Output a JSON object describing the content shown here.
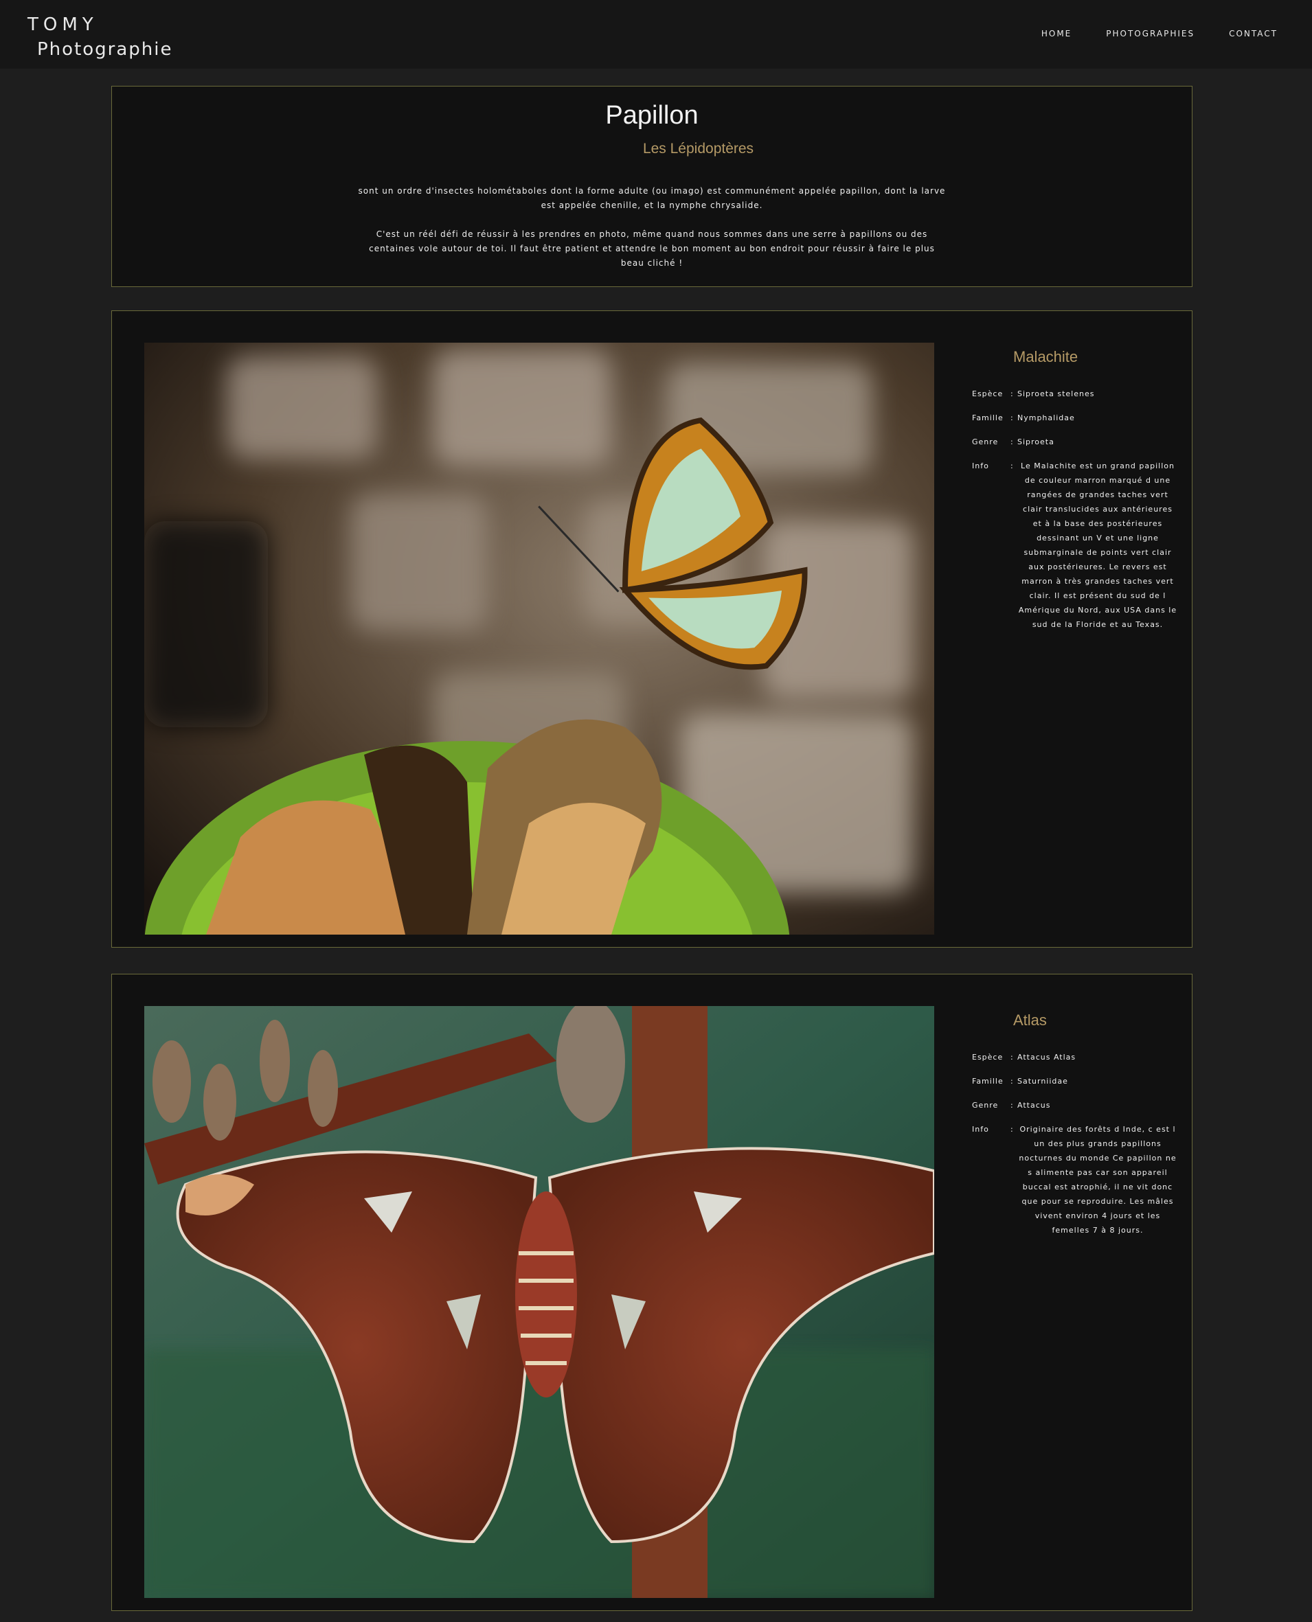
{
  "header": {
    "logo_line1": "TOMY",
    "logo_line2": "Photographie",
    "nav": [
      {
        "label": "HOME"
      },
      {
        "label": "PHOTOGRAPHIES"
      },
      {
        "label": "CONTACT"
      }
    ]
  },
  "intro": {
    "title": "Papillon",
    "subtitle": "Les Lépidoptères",
    "paragraph1": "sont un ordre d'insectes holométaboles dont la forme adulte (ou imago) est communément appelée papillon, dont la larve est appelée chenille, et la nymphe chrysalide.",
    "paragraph2": "C'est un réél défi de réussir à les prendres en photo, même quand nous sommes dans une serre à papillons ou des centaines vole autour de toi. Il faut être patient et attendre le bon moment au bon endroit pour réussir à faire le plus beau cliché !"
  },
  "cards": [
    {
      "name": "Malachite",
      "espece_label": "Espèce",
      "espece": "Siproeta stelenes",
      "famille_label": "Famille",
      "famille": "Nymphalidae",
      "genre_label": "Genre",
      "genre": "Siproeta",
      "info_label": "Info",
      "info": "Le Malachite est un grand papillon de couleur marron marqué d une rangées de grandes taches vert clair translucides aux antérieures et à la base des postérieures dessinant un V et une ligne submarginale de points vert clair aux postérieures. Le revers est marron à très grandes taches vert clair. Il est présent du sud de l Amérique du Nord, aux USA dans le sud de la Floride et au Texas."
    },
    {
      "name": "Atlas",
      "espece_label": "Espèce",
      "espece": "Attacus Atlas",
      "famille_label": "Famille",
      "famille": "Saturniidae",
      "genre_label": "Genre",
      "genre": "Attacus",
      "info_label": "Info",
      "info": "Originaire des forêts d Inde, c est l un des plus grands papillons nocturnes du monde Ce papillon ne s alimente pas car son appareil buccal est atrophié, il ne vit donc que pour se reproduire. Les mâles vivent environ 4 jours et les femelles 7 à 8 jours."
    }
  ],
  "colors": {
    "accent": "#b59a66",
    "border": "#6a6a3a",
    "panel_bg": "#111111",
    "page_bg": "#1e1e1e"
  }
}
